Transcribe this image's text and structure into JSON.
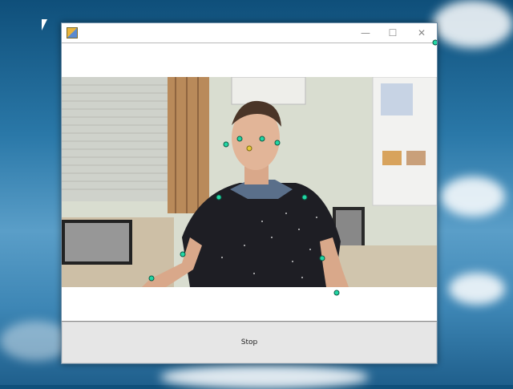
{
  "window": {
    "icon": "app-icon",
    "controls": {
      "minimize": "—",
      "maximize": "☐",
      "close": "✕"
    }
  },
  "video": {
    "description_icon": "camera-feed",
    "keypoint_color": "#22d6a4",
    "nose_color": "#e8c93a"
  },
  "footer": {
    "stop_label": "Stop"
  }
}
